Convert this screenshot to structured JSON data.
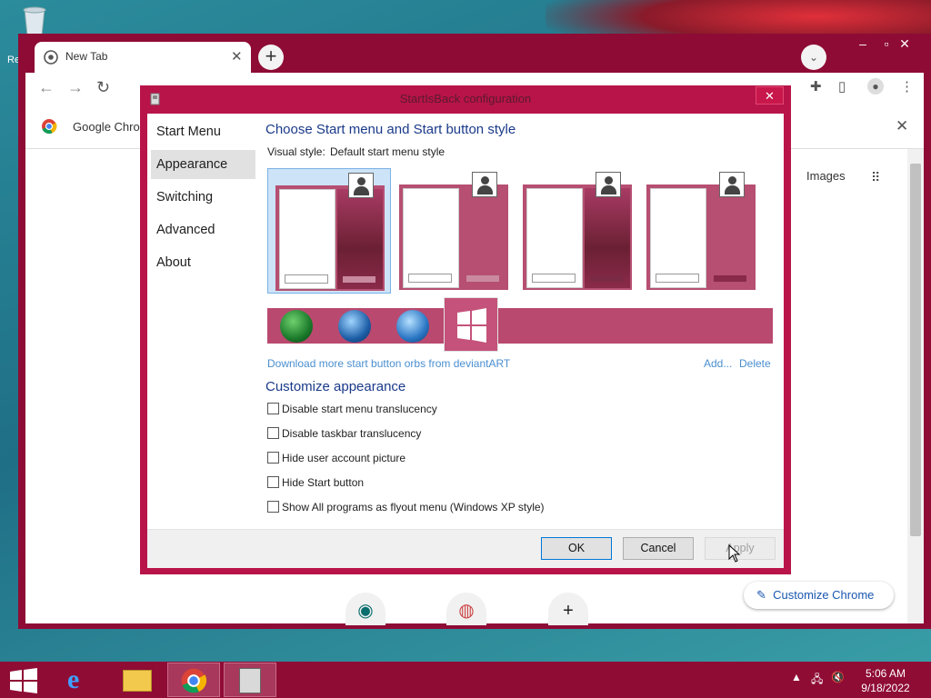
{
  "desktop": {
    "recycle_label": "Re"
  },
  "browser": {
    "tab_title": "New Tab",
    "bookmark_label": "Google Chro",
    "images_link": "Images",
    "customize_label": "Customize Chrome"
  },
  "dialog": {
    "title": "StartIsBack configuration",
    "nav": [
      "Start Menu",
      "Appearance",
      "Switching",
      "Advanced",
      "About"
    ],
    "selected_nav": "Appearance",
    "heading_style": "Choose Start menu and Start button style",
    "visual_style_label": "Visual style:",
    "visual_style_value": "Default start menu style",
    "download_link": "Download more start button orbs from deviantART",
    "add_link": "Add...",
    "delete_link": "Delete",
    "heading_customize": "Customize appearance",
    "options": [
      "Disable start menu translucency",
      "Disable taskbar translucency",
      "Hide user account picture",
      "Hide Start button",
      "Show All programs as flyout menu (Windows XP style)"
    ],
    "ok_label": "OK",
    "cancel_label": "Cancel",
    "apply_label": "Apply"
  },
  "taskbar": {
    "time": "5:06 AM",
    "date": "9/18/2022"
  },
  "colors": {
    "accent": "#8e0b35",
    "dialog_frame": "#b8144a",
    "link": "#4a8fd0"
  }
}
